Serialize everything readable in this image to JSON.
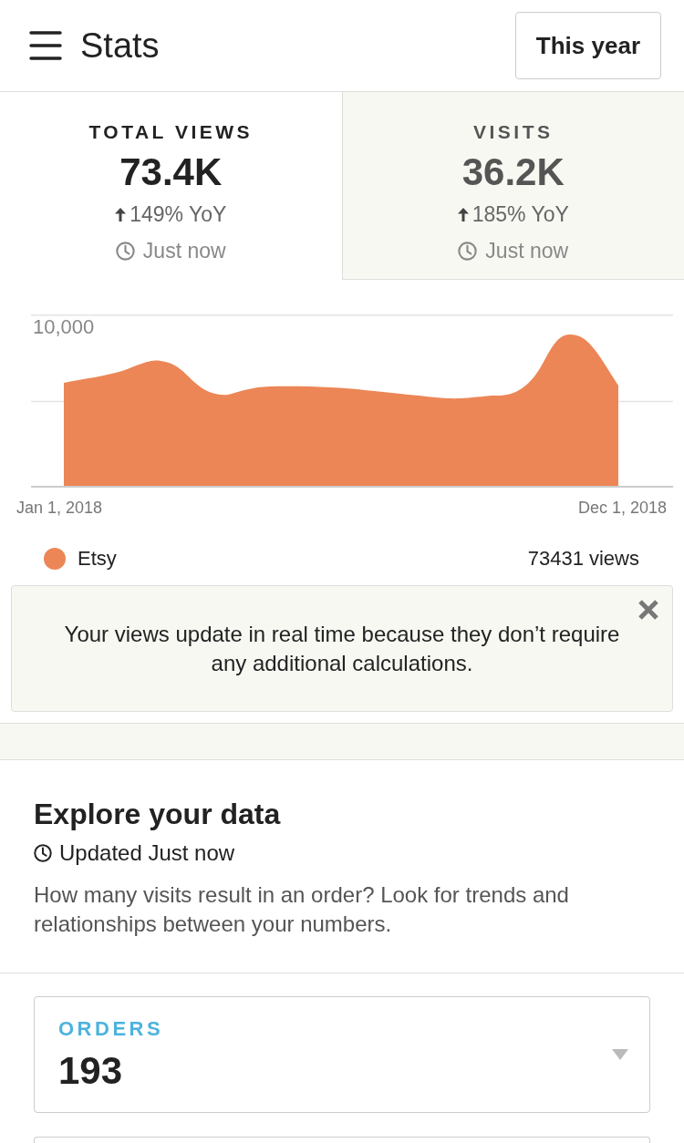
{
  "header": {
    "title": "Stats",
    "period_button": "This year"
  },
  "metric_tabs": [
    {
      "label": "TOTAL VIEWS",
      "value": "73.4K",
      "change": "149% YoY",
      "updated": "Just now",
      "selected": true
    },
    {
      "label": "VISITS",
      "value": "36.2K",
      "change": "185% YoY",
      "updated": "Just now",
      "selected": false
    }
  ],
  "chart": {
    "y_tick_label": "10,000",
    "x_labels": [
      "Jan 1, 2018",
      "Dec 1, 2018"
    ],
    "legend": {
      "name": "Etsy",
      "color": "#ec8656",
      "total": "73431 views"
    }
  },
  "notice": {
    "text": "Your views update in real time because they don’t require any additional calculations.",
    "closable": true
  },
  "explore": {
    "title": "Explore your data",
    "updated": "Updated Just now",
    "description": "How many visits result in an order? Look for trends and relationships between your numbers."
  },
  "explore_cards": [
    {
      "kind": "metric",
      "label": "ORDERS",
      "value": "193"
    },
    {
      "kind": "partial"
    }
  ]
}
